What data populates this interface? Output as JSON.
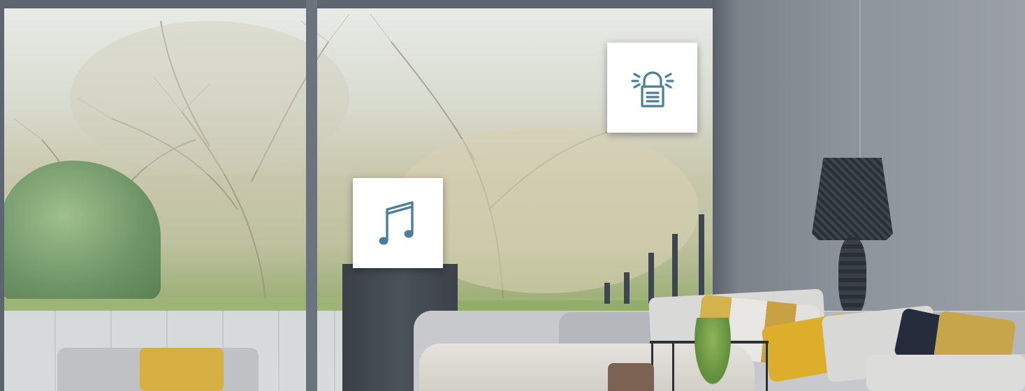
{
  "scene": {
    "icons": [
      {
        "name": "alarm-siren-icon",
        "color": "#4a7e9b"
      },
      {
        "name": "music-note-icon",
        "color": "#4a7e9b"
      }
    ],
    "palette": {
      "icon_blue": "#4a7e9b",
      "tile_white": "#ffffff",
      "wall_grey": "#8e949b",
      "frame_grey": "#5d6570",
      "cushion_yellow": "#dcae2c"
    }
  }
}
